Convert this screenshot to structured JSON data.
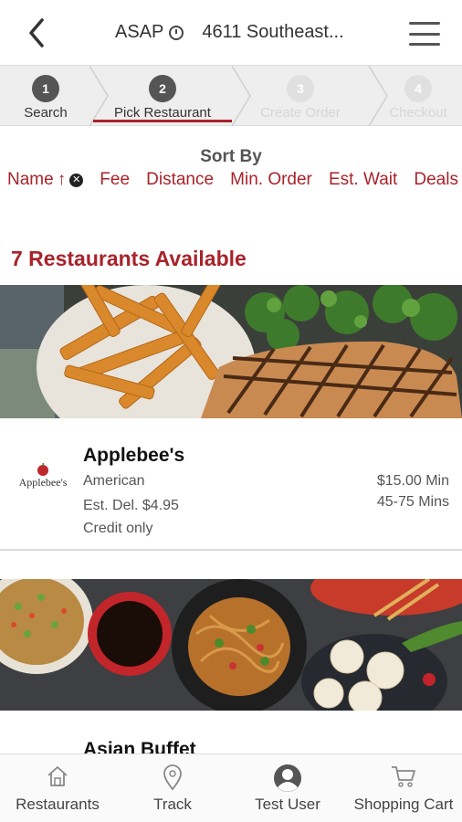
{
  "header": {
    "time": "ASAP",
    "address": "4611 Southeast..."
  },
  "steps": [
    {
      "num": "1",
      "label": "Search"
    },
    {
      "num": "2",
      "label": "Pick Restaurant"
    },
    {
      "num": "3",
      "label": "Create Order"
    },
    {
      "num": "4",
      "label": "Checkout"
    }
  ],
  "sort": {
    "title": "Sort By",
    "options": [
      "Name",
      "Fee",
      "Distance",
      "Min. Order",
      "Est. Wait",
      "Deals"
    ]
  },
  "restaurants_count": "7 Restaurants Available",
  "restaurants": [
    {
      "logo_text": "Applebee's",
      "name": "Applebee's",
      "cuisine": "American",
      "delivery_fee": "Est. Del. $4.95",
      "payment": "Credit only",
      "min_order": "$15.00 Min",
      "wait": "45-75 Mins"
    },
    {
      "name": "Asian Buffet"
    }
  ],
  "nav": {
    "items": [
      "Restaurants",
      "Track",
      "Test User",
      "Shopping Cart"
    ]
  },
  "colors": {
    "accent": "#a8232a"
  }
}
